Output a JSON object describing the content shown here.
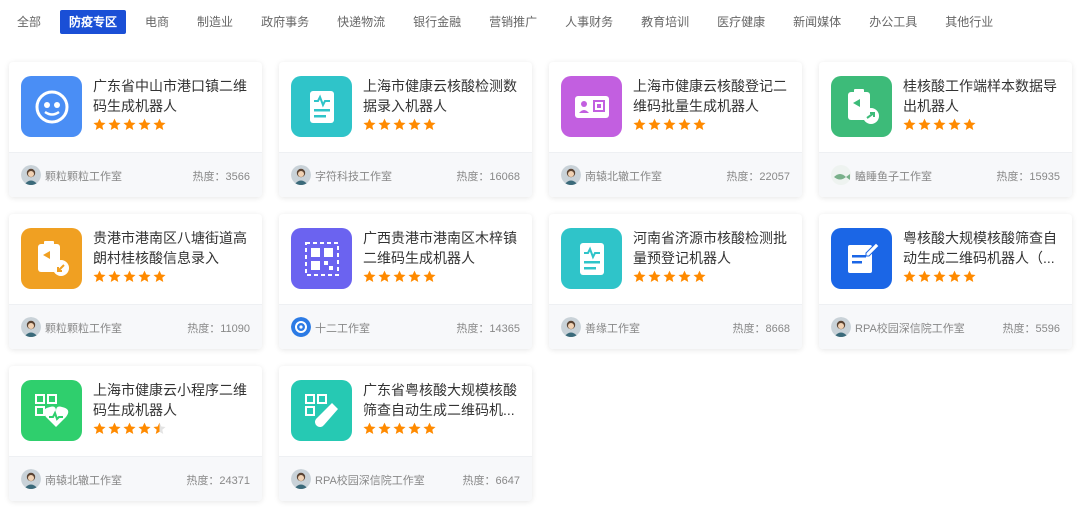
{
  "tabs": [
    {
      "label": "全部",
      "active": false
    },
    {
      "label": "防疫专区",
      "active": true
    },
    {
      "label": "电商",
      "active": false
    },
    {
      "label": "制造业",
      "active": false
    },
    {
      "label": "政府事务",
      "active": false
    },
    {
      "label": "快递物流",
      "active": false
    },
    {
      "label": "银行金融",
      "active": false
    },
    {
      "label": "营销推广",
      "active": false
    },
    {
      "label": "人事财务",
      "active": false
    },
    {
      "label": "教育培训",
      "active": false
    },
    {
      "label": "医疗健康",
      "active": false
    },
    {
      "label": "新闻媒体",
      "active": false
    },
    {
      "label": "办公工具",
      "active": false
    },
    {
      "label": "其他行业",
      "active": false
    }
  ],
  "heat_label": "热度：",
  "cards": [
    {
      "title": "广东省中山市港口镇二维码生成机器人",
      "stars": 5,
      "studio": "颗粒颗粒工作室",
      "heat": "3566",
      "icon": "robot-face-icon",
      "icon_bg": "#4a8ef5",
      "avatar": "person-avatar"
    },
    {
      "title": "上海市健康云核酸检测数据录入机器人",
      "stars": 5,
      "studio": "字符科技工作室",
      "heat": "16068",
      "icon": "document-heartbeat-icon",
      "icon_bg": "#2fc4c9",
      "avatar": "person-avatar"
    },
    {
      "title": "上海市健康云核酸登记二维码批量生成机器人",
      "stars": 5,
      "studio": "南辕北辙工作室",
      "heat": "22057",
      "icon": "id-card-qr-icon",
      "icon_bg": "#c25fe0",
      "avatar": "person-avatar"
    },
    {
      "title": "桂核酸工作端样本数据导出机器人",
      "stars": 5,
      "studio": "瞌睡鱼子工作室",
      "heat": "15935",
      "icon": "clipboard-export-icon",
      "icon_bg": "#3dbb79",
      "avatar": "fish-avatar"
    },
    {
      "title": "贵港市港南区八塘街道高朗村桂核酸信息录入",
      "stars": 5,
      "studio": "颗粒颗粒工作室",
      "heat": "11090",
      "icon": "clipboard-import-icon",
      "icon_bg": "#f0a022",
      "avatar": "person-avatar"
    },
    {
      "title": "广西贵港市港南区木梓镇二维码生成机器人",
      "stars": 5,
      "studio": "十二工作室",
      "heat": "14365",
      "icon": "qr-code-icon",
      "icon_bg": "#6b63f0",
      "avatar": "logo-avatar"
    },
    {
      "title": "河南省济源市核酸检测批量预登记机器人",
      "stars": 5,
      "studio": "善缘工作室",
      "heat": "8668",
      "icon": "document-heartbeat-icon",
      "icon_bg": "#2fc4c9",
      "avatar": "person-avatar"
    },
    {
      "title": "粤核酸大规模核酸筛查自动生成二维码机器人（...",
      "stars": 5,
      "studio": "RPA校园深信院工作室",
      "heat": "5596",
      "icon": "note-edit-icon",
      "icon_bg": "#1b66e6",
      "avatar": "person-avatar"
    },
    {
      "title": "上海市健康云小程序二维码生成机器人",
      "stars": 4.5,
      "studio": "南辕北辙工作室",
      "heat": "24371",
      "icon": "qr-heartbeat-icon",
      "icon_bg": "#2fcf6d",
      "avatar": "person-avatar"
    },
    {
      "title": "广东省粤核酸大规模核酸筛查自动生成二维码机...",
      "stars": 5,
      "studio": "RPA校园深信院工作室",
      "heat": "6647",
      "icon": "qr-test-tube-icon",
      "icon_bg": "#26c9b3",
      "avatar": "person-avatar"
    }
  ]
}
